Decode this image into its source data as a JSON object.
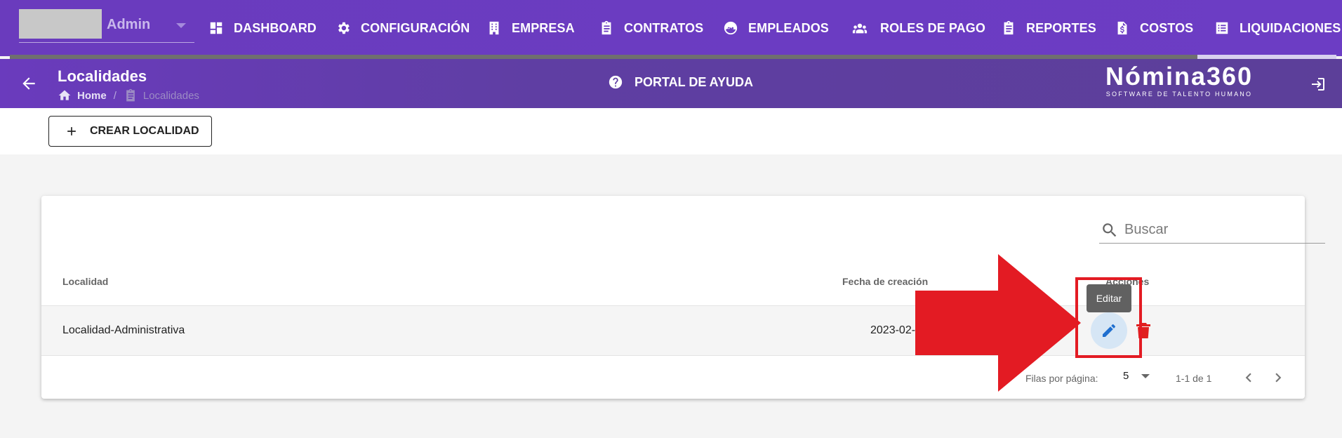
{
  "topnav": {
    "role": "Admin",
    "items": [
      {
        "label": "DASHBOARD",
        "icon": "dashboard-icon"
      },
      {
        "label": "CONFIGURACIÓN",
        "icon": "gear-icon"
      },
      {
        "label": "EMPRESA",
        "icon": "building-icon"
      },
      {
        "label": "CONTRATOS",
        "icon": "clipboard-icon"
      },
      {
        "label": "EMPLEADOS",
        "icon": "face-icon"
      },
      {
        "label": "ROLES DE PAGO",
        "icon": "group-icon"
      },
      {
        "label": "REPORTES",
        "icon": "clipboard-icon"
      },
      {
        "label": "COSTOS",
        "icon": "dollar-file-icon"
      },
      {
        "label": "LIQUIDACIONES",
        "icon": "list-icon"
      }
    ]
  },
  "header": {
    "title": "Localidades",
    "breadcrumb": {
      "home": "Home",
      "current": "Localidades"
    },
    "help": "PORTAL DE AYUDA",
    "logo": {
      "name": "Nómina360",
      "tagline": "SOFTWARE DE TALENTO HUMANO"
    }
  },
  "actions": {
    "create_label": "CREAR LOCALIDAD"
  },
  "table": {
    "search_placeholder": "Buscar",
    "columns": {
      "localidad": "Localidad",
      "fecha": "Fecha de creación",
      "acciones": "Acciones"
    },
    "rows": [
      {
        "localidad": "Localidad-Administrativa",
        "fecha": "2023-02-"
      }
    ],
    "tooltip": "Editar",
    "footer": {
      "rows_per_page_label": "Filas por página:",
      "rows_per_page": "5",
      "range": "1-1 de 1"
    }
  },
  "colors": {
    "brand": "#6a3bbd",
    "annotation": "#e31b23",
    "edit": "#1f6fcf",
    "delete": "#e0201f"
  }
}
